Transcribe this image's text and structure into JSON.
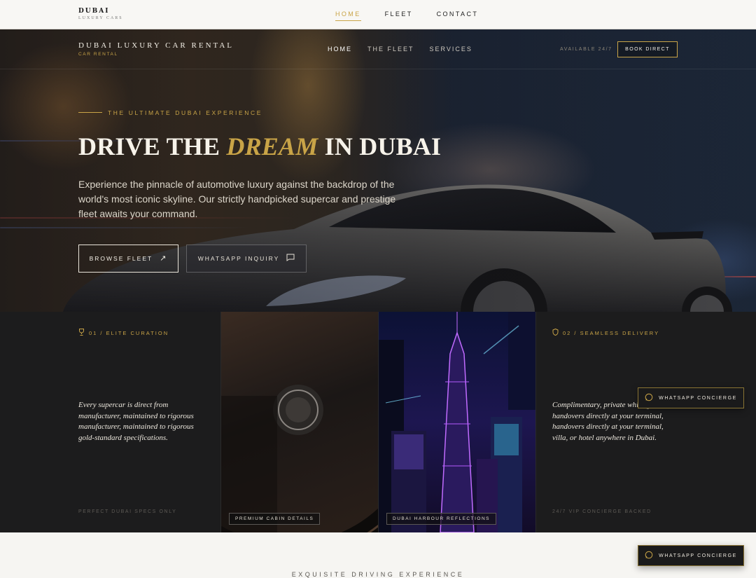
{
  "topbar": {
    "brand_main": "DUBAI",
    "brand_sub": "LUXURY CARS",
    "nav": [
      "HOME",
      "FLEET",
      "CONTACT"
    ]
  },
  "hero": {
    "brand_main": "DUBAI LUXURY CAR RENTAL",
    "brand_sub": "CAR RENTAL",
    "nav": [
      "HOME",
      "THE FLEET",
      "SERVICES"
    ],
    "availability": "AVAILABLE 24/7",
    "book_label": "BOOK DIRECT",
    "eyebrow": "THE ULTIMATE DUBAI EXPERIENCE",
    "title_pre": "DRIVE THE ",
    "title_accent": "DREAM",
    "title_post": " IN DUBAI",
    "description": "Experience the pinnacle of automotive luxury against the backdrop of the world's most iconic skyline. Our strictly handpicked supercar and prestige fleet awaits your command.",
    "browse_label": "BROWSE FLEET",
    "whatsapp_label": "WHATSAPP INQUIRY"
  },
  "features": {
    "curation": {
      "label": "01 / ELITE CURATION",
      "text": "Every supercar is direct from manufacturer, maintained to rigorous manufacturer, maintained to rigorous gold-standard specifications.",
      "footer": "PERFECT DUBAI SPECS ONLY"
    },
    "cabin_caption": "PREMIUM CABIN DETAILS",
    "harbour_caption": "DUBAI HARBOUR REFLECTIONS",
    "delivery": {
      "label": "02 / SEAMLESS DELIVERY",
      "text": "Complimentary, private white-glove handovers directly at your terminal, handovers directly at your terminal, villa, or hotel anywhere in Dubai.",
      "footer": "24/7 VIP CONCIERGE BACKED"
    }
  },
  "concierge_label": "WHATSAPP CONCIERGE",
  "section_title": "EXQUISITE DRIVING EXPERIENCE",
  "colors": {
    "gold": "#c9a447",
    "dark": "#1b1b1c",
    "light": "#f6f5f2"
  },
  "icons": [
    "arrow-up-right-icon",
    "chat-icon",
    "trophy-icon",
    "shield-icon",
    "whatsapp-icon"
  ]
}
